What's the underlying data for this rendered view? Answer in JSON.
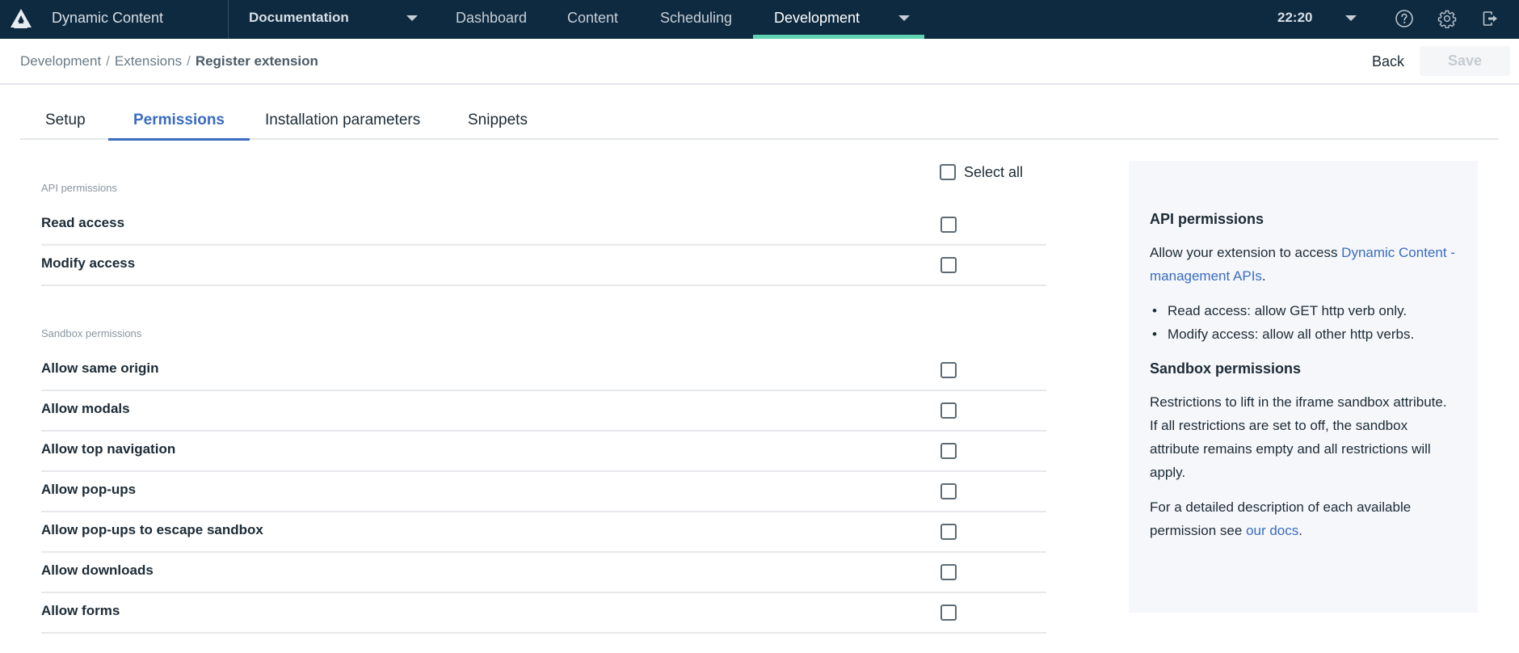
{
  "topbar": {
    "app_name": "Dynamic Content",
    "hub_selector": "Documentation",
    "nav_items": [
      {
        "label": "Dashboard",
        "active": false
      },
      {
        "label": "Content",
        "active": false
      },
      {
        "label": "Scheduling",
        "active": false
      },
      {
        "label": "Development",
        "active": true
      }
    ],
    "time": "22:20",
    "icons": [
      "logo-icon",
      "help-icon",
      "settings-icon",
      "logout-icon"
    ],
    "accent_color": "#5fd3b0",
    "background_color": "#0e2a40"
  },
  "breadcrumb": {
    "items": [
      "Development",
      "Extensions",
      "Register extension"
    ],
    "separator": "/"
  },
  "actions": {
    "back_label": "Back",
    "save_label": "Save",
    "save_disabled": true
  },
  "tabs": [
    {
      "label": "Setup",
      "active": false
    },
    {
      "label": "Permissions",
      "active": true
    },
    {
      "label": "Installation parameters",
      "active": false
    },
    {
      "label": "Snippets",
      "active": false
    }
  ],
  "permissions": {
    "select_all_label": "Select all",
    "select_all_checked": false,
    "api_section": {
      "title": "API permissions",
      "items": [
        {
          "label": "Read access",
          "checked": false
        },
        {
          "label": "Modify access",
          "checked": false
        }
      ]
    },
    "sandbox_section": {
      "title": "Sandbox permissions",
      "items": [
        {
          "label": "Allow same origin",
          "checked": false
        },
        {
          "label": "Allow modals",
          "checked": false
        },
        {
          "label": "Allow top navigation",
          "checked": false
        },
        {
          "label": "Allow pop-ups",
          "checked": false
        },
        {
          "label": "Allow pop-ups to escape sandbox",
          "checked": false
        },
        {
          "label": "Allow downloads",
          "checked": false
        },
        {
          "label": "Allow forms",
          "checked": false
        }
      ]
    }
  },
  "help": {
    "api_heading": "API permissions",
    "api_intro_prefix": "Allow your extension to access ",
    "api_intro_link": "Dynamic Content - management APIs",
    "api_intro_suffix": ".",
    "api_bullets": [
      "Read access: allow GET http verb only.",
      "Modify access: allow all other http verbs."
    ],
    "sandbox_heading": "Sandbox permissions",
    "sandbox_text": "Restrictions to lift in the iframe sandbox attribute. If all restrictions are set to off, the sandbox attribute remains empty and all restrictions will apply.",
    "docs_prefix": "For a detailed description of each available permission see ",
    "docs_link": "our docs",
    "docs_suffix": ".",
    "link_color": "#3a6cc0"
  }
}
